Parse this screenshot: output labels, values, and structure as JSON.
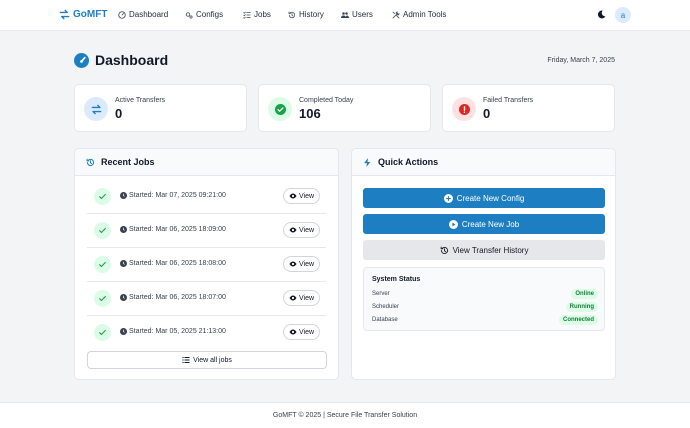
{
  "navbar": {
    "brand": "GoMFT",
    "items": [
      {
        "label": "Dashboard",
        "icon": "gauge-icon"
      },
      {
        "label": "Configs",
        "icon": "cogs-icon"
      },
      {
        "label": "Jobs",
        "icon": "tasks-icon"
      },
      {
        "label": "History",
        "icon": "history-icon"
      },
      {
        "label": "Users",
        "icon": "users-icon"
      },
      {
        "label": "Admin Tools",
        "icon": "tools-icon"
      }
    ],
    "theme_icon": "moon-icon",
    "avatar_letter": "a"
  },
  "page": {
    "title": "Dashboard",
    "date": "Friday, March 7, 2025"
  },
  "stats": [
    {
      "label": "Active Transfers",
      "value": "0",
      "icon": "exchange-icon",
      "color": "#1d7fc1"
    },
    {
      "label": "Completed Today",
      "value": "106",
      "icon": "check-circle-icon",
      "color": "#16a34a"
    },
    {
      "label": "Failed Transfers",
      "value": "0",
      "icon": "exclamation-circle-icon",
      "color": "#dc2626"
    }
  ],
  "recent_jobs": {
    "title": "Recent Jobs",
    "items": [
      {
        "started": "Started: Mar 07, 2025 09:21:00",
        "action": "View"
      },
      {
        "started": "Started: Mar 06, 2025 18:09:00",
        "action": "View"
      },
      {
        "started": "Started: Mar 06, 2025 18:08:00",
        "action": "View"
      },
      {
        "started": "Started: Mar 06, 2025 18:07:00",
        "action": "View"
      },
      {
        "started": "Started: Mar 05, 2025 21:13:00",
        "action": "View"
      }
    ],
    "view_all_label": "View all jobs"
  },
  "quick_actions": {
    "title": "Quick Actions",
    "buttons": [
      {
        "label": "Create New Config",
        "icon": "plus-circle-icon"
      },
      {
        "label": "Create New Job",
        "icon": "play-circle-icon"
      },
      {
        "label": "View Transfer History",
        "icon": "history-icon"
      }
    ],
    "system_status": {
      "title": "System Status",
      "rows": [
        {
          "label": "Server",
          "status": "Online"
        },
        {
          "label": "Scheduler",
          "status": "Running"
        },
        {
          "label": "Database",
          "status": "Connected"
        }
      ]
    }
  },
  "footer": {
    "text": "GoMFT © 2025 | Secure File Transfer Solution"
  },
  "colors": {
    "accent": "#1d7fc1",
    "success": "#16a34a",
    "danger": "#dc2626"
  }
}
